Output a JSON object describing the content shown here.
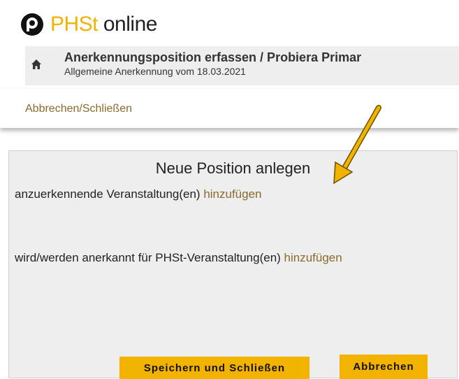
{
  "logo": {
    "prefix": "PHSt",
    "suffix": " online"
  },
  "header": {
    "title": "Anerkennungsposition erfassen  / Probiera Primar",
    "subtitle": "Allgemeine Anerkennung vom 18.03.2021"
  },
  "toolbar": {
    "cancel_close_label": "Abbrechen/Schließen"
  },
  "dialog": {
    "title": "Neue Position anlegen",
    "row1": {
      "text": "anzuerkennende Veranstaltung(en) ",
      "link": "hinzufügen"
    },
    "row2": {
      "text": "wird/werden anerkannt für PHSt-Veranstaltung(en) ",
      "link": "hinzufügen"
    },
    "save_button": "Speichern und Schließen",
    "cancel_button": "Abbrechen"
  },
  "colors": {
    "accent": "#f2b200",
    "link": "#8b6a2e",
    "panel": "#eeeeee",
    "arrow": "#f2b200"
  },
  "icons": [
    "logo-p-icon",
    "home-icon",
    "annotation-arrow"
  ]
}
